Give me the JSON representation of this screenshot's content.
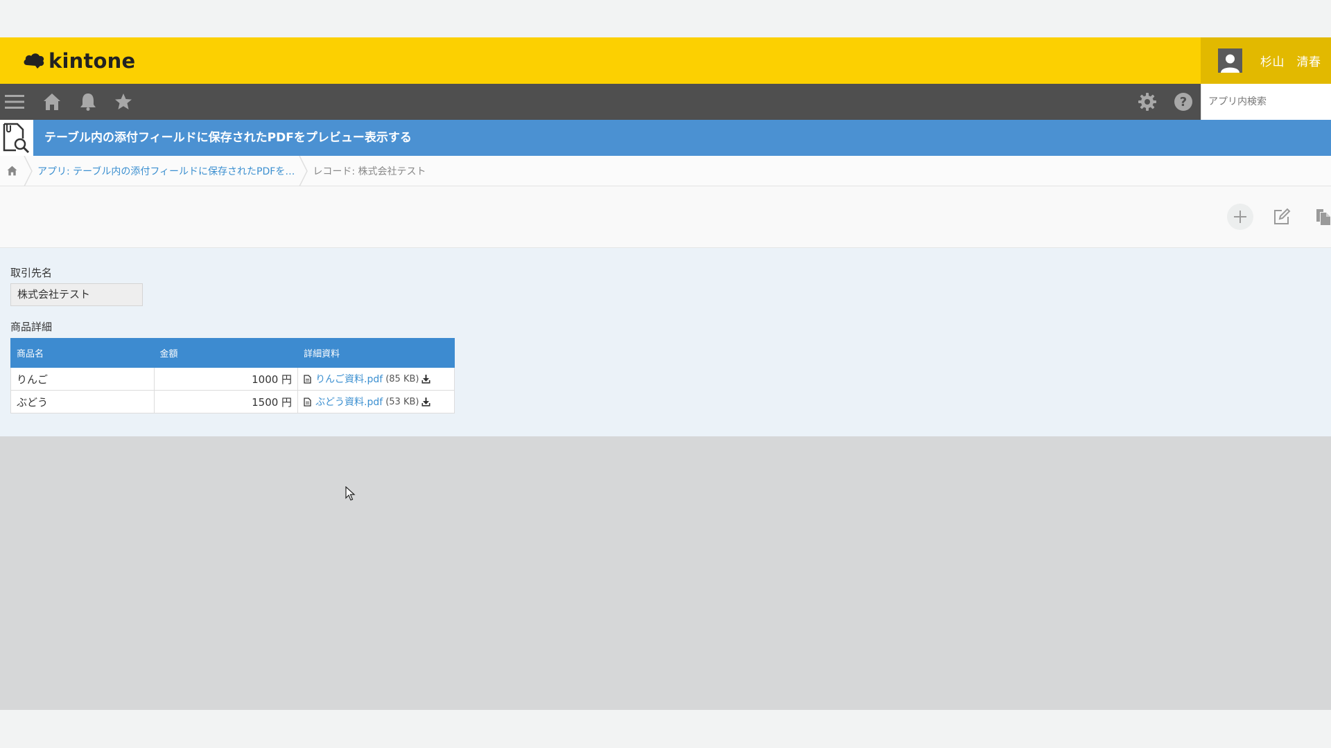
{
  "header": {
    "logo_text": "kintone",
    "user_name": "杉山　清春"
  },
  "toolbar": {
    "search_placeholder": "アプリ内検索",
    "icons": [
      "menu-icon",
      "home-icon",
      "bell-icon",
      "star-icon",
      "gear-icon",
      "help-icon"
    ]
  },
  "app": {
    "title": "テーブル内の添付フィールドに保存されたPDFをプレビュー表示する"
  },
  "breadcrumb": {
    "app_link": "アプリ: テーブル内の添付フィールドに保存されたPDFを…",
    "record": "レコード: 株式会社テスト"
  },
  "record": {
    "client_label": "取引先名",
    "client_value": "株式会社テスト",
    "table_label": "商品詳細",
    "table": {
      "headers": [
        "商品名",
        "金額",
        "詳細資料"
      ],
      "rows": [
        {
          "name": "りんご",
          "amount": "1000 円",
          "file": "りんご資料.pdf",
          "size": "(85 KB)"
        },
        {
          "name": "ぶどう",
          "amount": "1500 円",
          "file": "ぶどう資料.pdf",
          "size": "(53 KB)"
        }
      ]
    }
  },
  "colors": {
    "header_yellow": "#fcd001",
    "toolbar_gray": "#4f4f4f",
    "title_blue": "#4b91d2",
    "table_header_blue": "#3d8bd0",
    "link_blue": "#3b8fd0"
  }
}
